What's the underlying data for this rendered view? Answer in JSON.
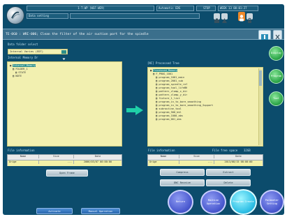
{
  "colors": {
    "screen_bg": "#0c4c6c",
    "panel": "#f2f0b0",
    "selection": "#2d8f8a",
    "arrow": "#1fd0a8",
    "accent_orange": "#f08a2a"
  },
  "header": {
    "line1_center": "1-T:WP (WSF-WE9)",
    "line1_right_a": "Automatic EDS",
    "line1_right_b": "STOP",
    "line1_right_c": "WEEK 13 00:01:27",
    "line2_left": "Data setting",
    "icons": [
      "camera-icon",
      "warning-icon",
      "user-icon",
      "lock-icon"
    ]
  },
  "message_bar": {
    "text": "TE-0G0 : WRI-006; Clean the filter of the air suction port for the spindle"
  },
  "left_panel": {
    "select_label": "Data folder select",
    "select_value": "Internal Varies (EDT)",
    "tree_label": "Internal Memory Dr",
    "tree_items": [
      "Internal_Memory",
      "FOLDER_1",
      "STATE",
      "NOTE"
    ]
  },
  "right_panel": {
    "tree_label": "[NC] Processed Tree",
    "file_count_label": "2/3",
    "tree_items": [
      "Processed_Memory",
      "F_PROG_1001",
      "program_1001_main",
      "program_2001_sub",
      "program_spindle_ref",
      "program_tool_lifeBK",
      "pattern_clamp_x_dir",
      "pattern_clamp_y_dir",
      "fixture_1_list",
      "program_in_to_bore_smoothing",
      "program_in_to_bore_smoothing_Support",
      "subroutine_tool",
      "program_500_bkl",
      "program_1000_abs",
      "program_001_abs"
    ]
  },
  "left_table": {
    "label": "File information",
    "headers": [
      "Name",
      "Size",
      "Date"
    ],
    "row": [
      "Orige",
      "---",
      "2006/03/07 00:00:00"
    ]
  },
  "right_table": {
    "label": "File information",
    "extra_label": "File free space",
    "extra_value": "32GB",
    "headers": [
      "Name",
      "Size",
      "Date"
    ],
    "row": [
      "Orige",
      "---",
      "2013/08/15 08:00:00"
    ]
  },
  "buttons": {
    "open_frame": "Open Frame",
    "compress": "Compress",
    "extract": "Extract",
    "dnc_receive": "DNC Receive",
    "delete": "Delete",
    "activate": "Activate",
    "manual_operation": "Manual Operation"
  },
  "side_buttons": [
    "Display",
    "Program",
    "Tool"
  ],
  "round_buttons": [
    "Return",
    "Machine Operation",
    "Program Create",
    "Parameter Setting"
  ]
}
